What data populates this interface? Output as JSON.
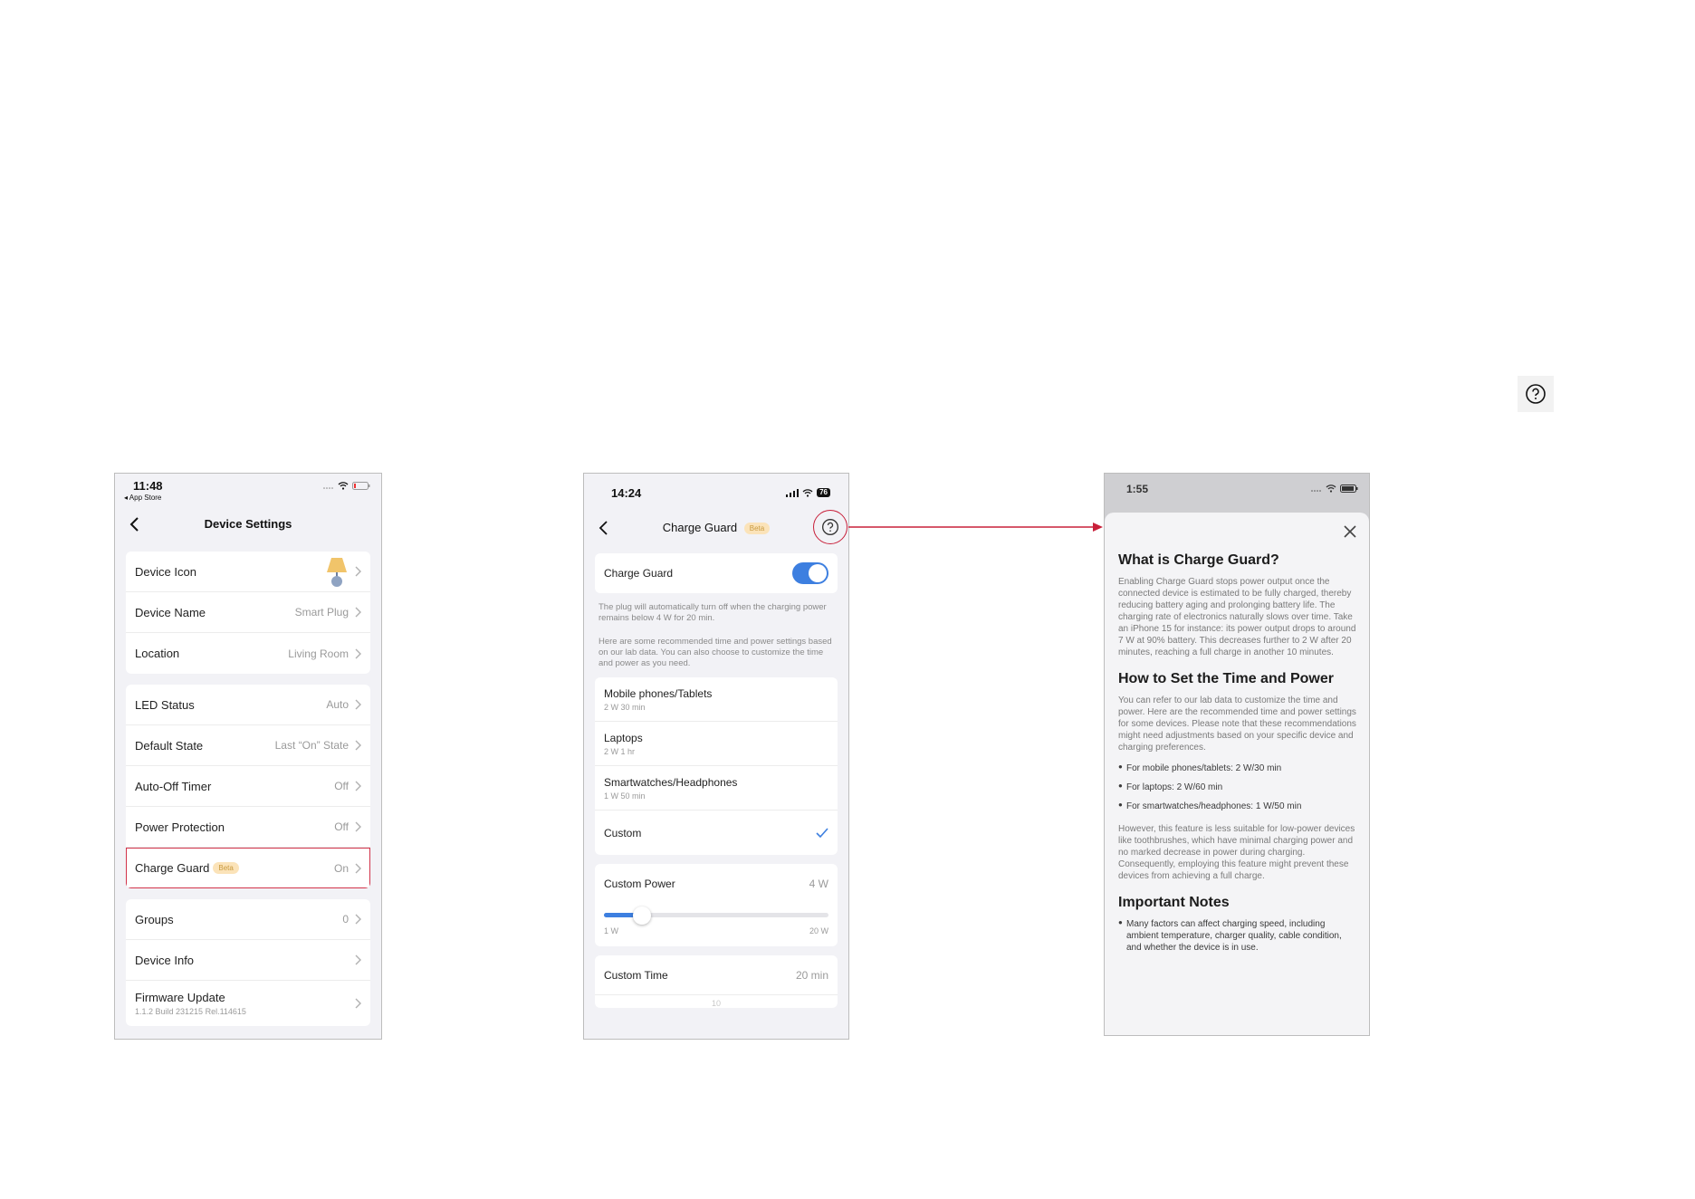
{
  "phone1": {
    "status": {
      "time": "11:48",
      "back_app": "◂ App Store"
    },
    "title": "Device Settings",
    "group1": [
      {
        "label": "Device Icon",
        "value": ""
      },
      {
        "label": "Device Name",
        "value": "Smart Plug"
      },
      {
        "label": "Location",
        "value": "Living Room"
      }
    ],
    "group2": [
      {
        "label": "LED Status",
        "value": "Auto"
      },
      {
        "label": "Default State",
        "value": "Last “On” State"
      },
      {
        "label": "Auto-Off Timer",
        "value": "Off"
      },
      {
        "label": "Power Protection",
        "value": "Off"
      },
      {
        "label": "Charge Guard",
        "badge": "Beta",
        "value": "On"
      }
    ],
    "group3": [
      {
        "label": "Groups",
        "value": "0"
      },
      {
        "label": "Device Info",
        "value": ""
      },
      {
        "label": "Firmware Update",
        "sub": "1.1.2 Build 231215 Rel.114615",
        "value": ""
      }
    ]
  },
  "phone2": {
    "status": {
      "time": "14:24",
      "battery": "76"
    },
    "title": "Charge Guard",
    "badge": "Beta",
    "toggle_label": "Charge Guard",
    "note1": "The plug will automatically turn off when the charging power remains below 4 W for 20 min.",
    "note2": "Here are some recommended time and power settings based on our lab data. You can also choose to customize the time and power as you need.",
    "options": [
      {
        "label": "Mobile phones/Tablets",
        "sub": "2 W 30 min"
      },
      {
        "label": "Laptops",
        "sub": "2 W 1 hr"
      },
      {
        "label": "Smartwatches/Headphones",
        "sub": "1 W 50 min"
      },
      {
        "label": "Custom",
        "sub": ""
      }
    ],
    "custom_power": {
      "label": "Custom Power",
      "value": "4 W",
      "min": "1 W",
      "max": "20 W",
      "fraction": 0.17
    },
    "custom_time": {
      "label": "Custom Time",
      "value": "20 min",
      "peek": "10"
    }
  },
  "phone3": {
    "status": {
      "time": "1:55"
    },
    "h1": "What is Charge Guard?",
    "p1": "Enabling Charge Guard stops power output once the connected device is estimated to be fully charged, thereby reducing battery aging and prolonging battery life. The charging rate of electronics naturally slows over time. Take an iPhone 15 for instance: its power output drops to around 7 W at 90% battery. This decreases further to 2 W after 20 minutes, reaching a full charge in another 10 minutes.",
    "h2": "How to Set the Time and Power",
    "p2": "You can refer to our lab data to customize the time and power. Here are the recommended time and power settings for some devices. Please note that these recommendations might need adjustments based on your specific device and charging preferences.",
    "list": [
      "For mobile phones/tablets: 2 W/30 min",
      "For laptops: 2 W/60 min",
      "For smartwatches/headphones: 1 W/50 min"
    ],
    "p3": "However, this feature is less suitable for low-power devices like toothbrushes, which have minimal charging power and no marked decrease in power during charging. Consequently, employing this feature might prevent these devices from achieving a full charge.",
    "h3": "Important Notes",
    "notes": [
      "Many factors can affect charging speed, including ambient temperature, charger quality, cable condition, and whether the device is in use."
    ]
  },
  "colors": {
    "accent": "#3d7fe0",
    "highlight": "#c8203a",
    "beta_bg": "#fbe3b9"
  },
  "icons": [
    "help-icon",
    "back-chevron-icon",
    "chevron-right-icon",
    "lamp-icon",
    "wifi-icon",
    "battery-icon",
    "close-icon",
    "checkmark-icon"
  ]
}
